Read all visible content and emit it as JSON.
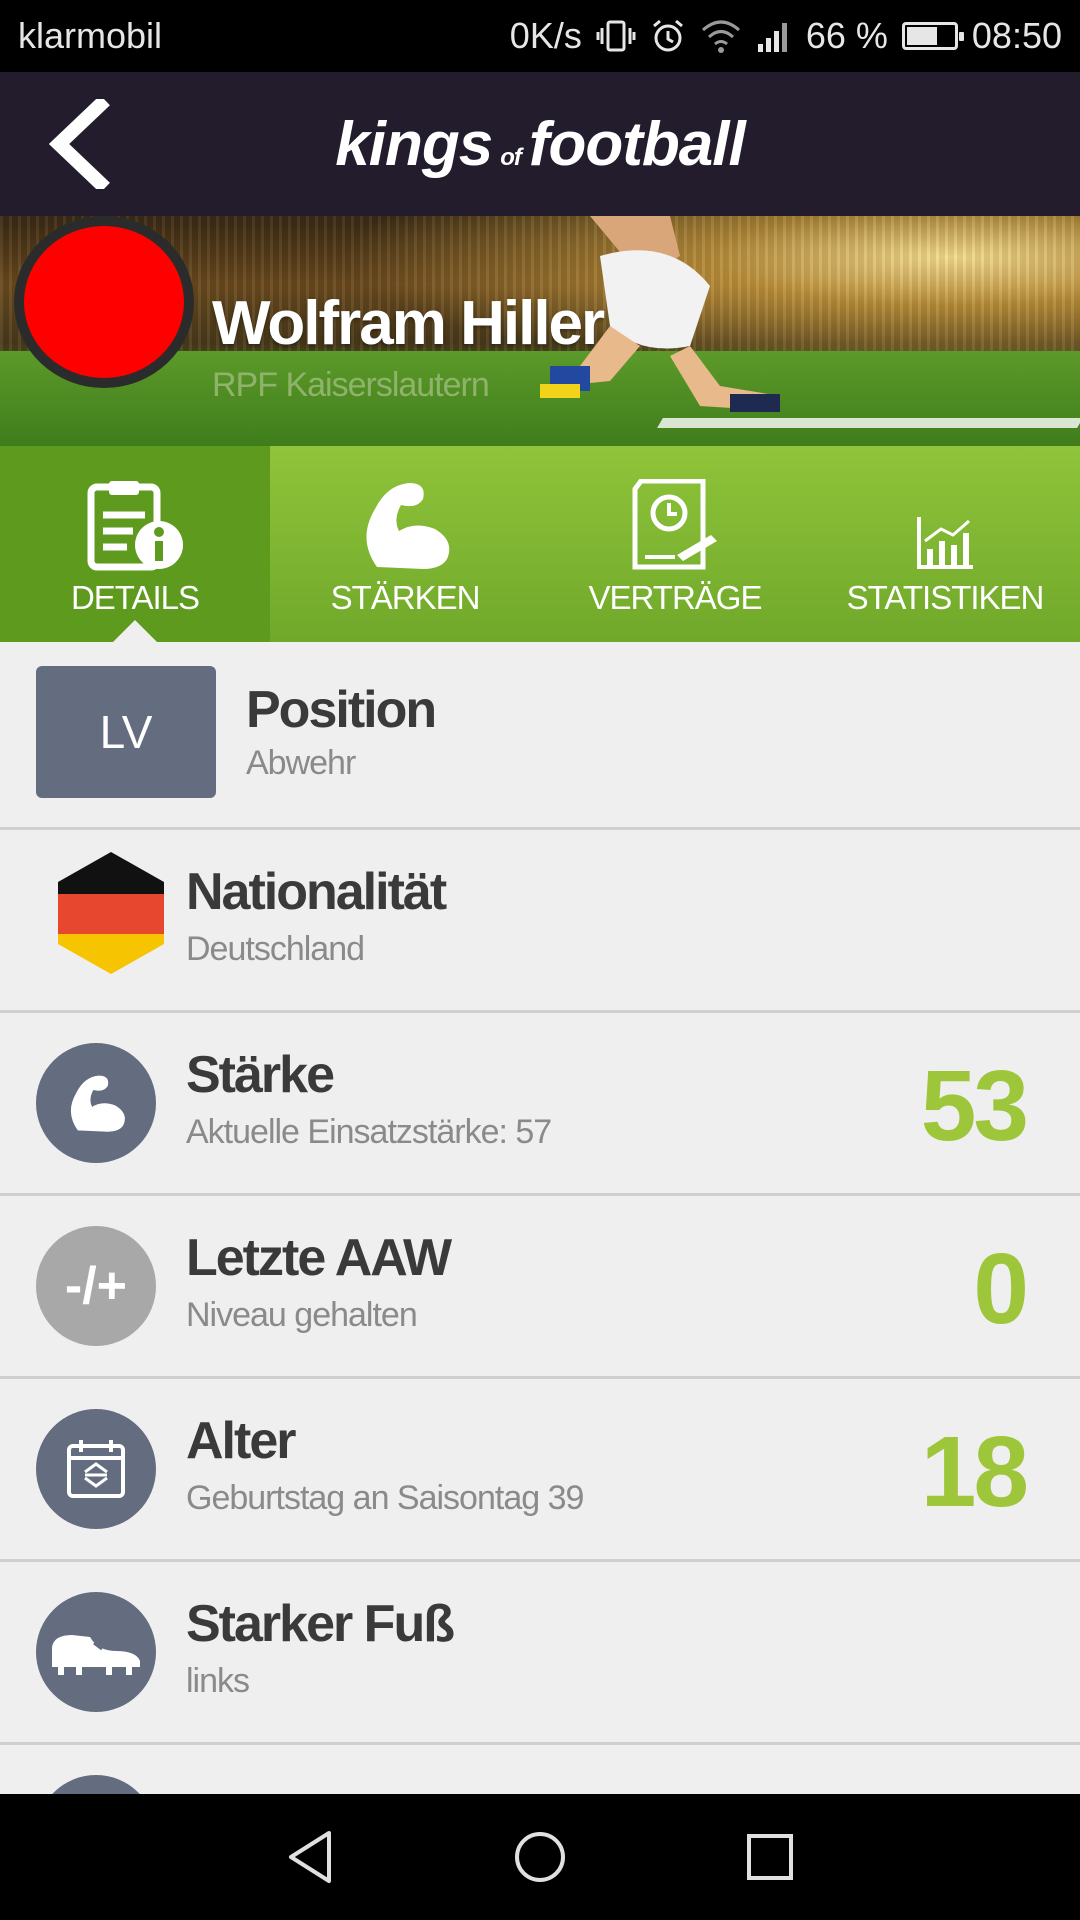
{
  "status_bar": {
    "carrier": "klarmobil",
    "speed": "0K/s",
    "battery_text": "66 %",
    "battery_level": 0.66,
    "time": "08:50"
  },
  "header": {
    "logo_part1": "kings",
    "logo_of": "of",
    "logo_part2": "football"
  },
  "player": {
    "name": "Wolfram Hiller",
    "club": "RPF Kaiserslautern",
    "avatar_color": "#ff0000"
  },
  "tabs": [
    {
      "label": "DETAILS",
      "icon": "details-icon",
      "active": true
    },
    {
      "label": "STÄRKEN",
      "icon": "muscle-icon",
      "active": false
    },
    {
      "label": "VERTRÄGE",
      "icon": "contract-icon",
      "active": false
    },
    {
      "label": "STATISTIKEN",
      "icon": "stats-icon",
      "active": false
    }
  ],
  "details": {
    "position": {
      "badge": "LV",
      "title": "Position",
      "subtitle": "Abwehr"
    },
    "nationality": {
      "title": "Nationalität",
      "subtitle": "Deutschland",
      "icon": "germany-flag-icon"
    },
    "strength": {
      "title": "Stärke",
      "subtitle": "Aktuelle Einsatzstärke: 57",
      "value": "53",
      "icon": "muscle-icon"
    },
    "last_aaw": {
      "title": "Letzte AAW",
      "subtitle": "Niveau gehalten",
      "value": "0",
      "icon_text": "-/+"
    },
    "age": {
      "title": "Alter",
      "subtitle": "Geburtstag an Saisontag 39",
      "value": "18",
      "icon": "calendar-icon"
    },
    "foot": {
      "title": "Starker Fuß",
      "subtitle": "links",
      "icon": "boot-icon"
    }
  },
  "colors": {
    "accent_green": "#9ec63a",
    "tab_green": "#8fc43a",
    "icon_slate": "#646c80",
    "header_bg": "#221c2c"
  }
}
